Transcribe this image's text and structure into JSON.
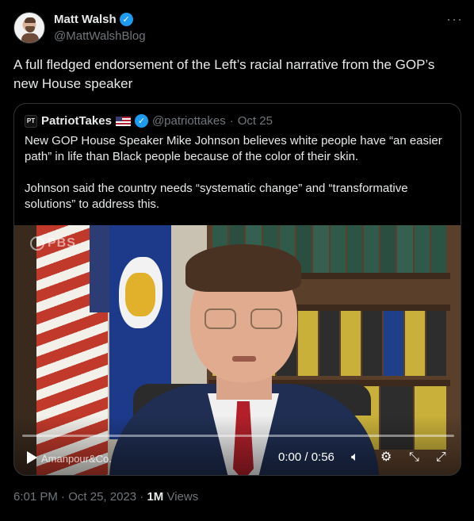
{
  "author": {
    "name": "Matt Walsh",
    "handle": "@MattWalshBlog",
    "verified": true
  },
  "more_icon": "more-horizontal-icon",
  "tweet_text": "A full fledged endorsement of the Left’s racial narrative from the GOP’s new House speaker",
  "quote": {
    "avatar_text": "PT",
    "name": "PatriotTakes",
    "handle": "@patriottakes",
    "separator": "·",
    "date": "Oct 25",
    "paragraph_1": "New GOP House Speaker Mike Johnson believes white people have “an easier path” in life than Black people because of the color of their skin.",
    "paragraph_2": "Johnson said the country needs “systematic change” and “transformative solutions” to address this."
  },
  "video": {
    "watermark": "PBS",
    "brand": "Amanpour&Co.",
    "time": "0:00 / 0:56",
    "progress": 0.0,
    "controls": {
      "volume_icon": "volume-icon",
      "settings_icon": "gear-icon",
      "minimize_icon": "minimize-icon",
      "fullscreen_icon": "fullscreen-icon"
    }
  },
  "meta": {
    "time": "6:01 PM",
    "date": "Oct 25, 2023",
    "separator": "·",
    "views_count": "1M",
    "views_label": "Views"
  },
  "colors": {
    "background": "#000000",
    "text": "#e7e9ea",
    "muted": "#71767b",
    "verified": "#1d9bf0",
    "border": "#2f3336"
  }
}
